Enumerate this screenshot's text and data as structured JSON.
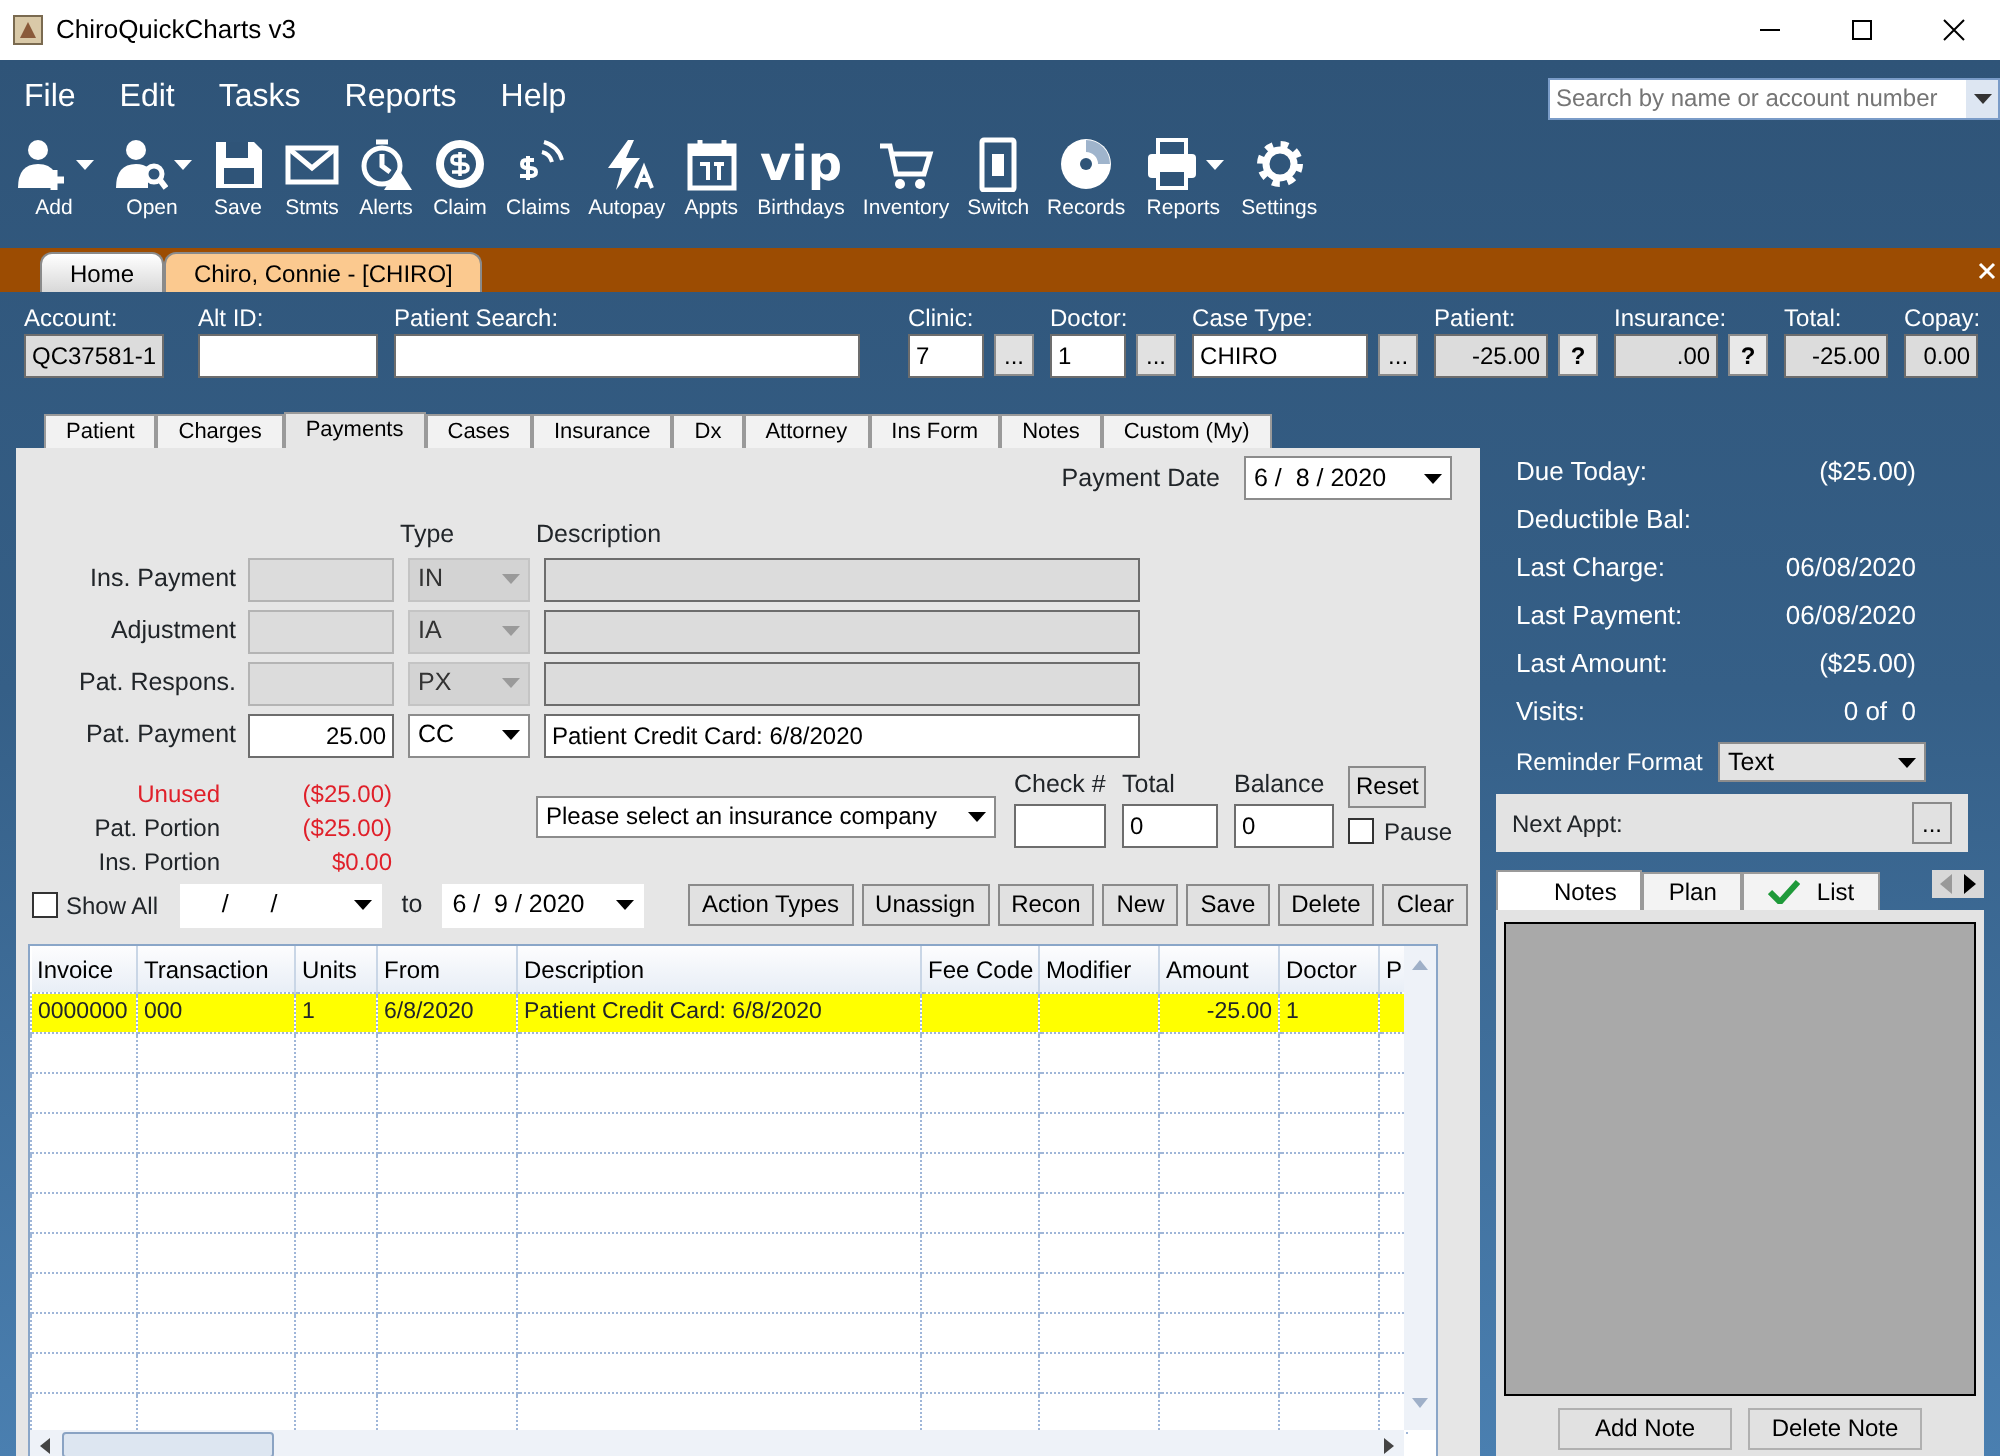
{
  "window": {
    "title": "ChiroQuickCharts v3"
  },
  "menu": [
    "File",
    "Edit",
    "Tasks",
    "Reports",
    "Help"
  ],
  "search": {
    "placeholder": "Search by name or account number"
  },
  "toolbar": [
    {
      "label": "Add",
      "kind": "add",
      "dropdown": true
    },
    {
      "label": "Open",
      "kind": "open",
      "dropdown": true
    },
    {
      "label": "Save",
      "kind": "save",
      "dropdown": false
    },
    {
      "label": "Stmts",
      "kind": "stmts",
      "dropdown": false
    },
    {
      "label": "Alerts",
      "kind": "alerts",
      "dropdown": false
    },
    {
      "label": "Claim",
      "kind": "claim",
      "dropdown": false
    },
    {
      "label": "Claims",
      "kind": "claims",
      "dropdown": false
    },
    {
      "label": "Autopay",
      "kind": "autopay",
      "dropdown": false
    },
    {
      "label": "Appts",
      "kind": "appts",
      "dropdown": false
    },
    {
      "label": "Birthdays",
      "kind": "vip",
      "glyph": "vip",
      "dropdown": false
    },
    {
      "label": "Inventory",
      "kind": "inventory",
      "dropdown": false
    },
    {
      "label": "Switch",
      "kind": "switch",
      "dropdown": false
    },
    {
      "label": "Records",
      "kind": "records",
      "dropdown": false
    },
    {
      "label": "Reports",
      "kind": "reports",
      "dropdown": true
    },
    {
      "label": "Settings",
      "kind": "settings",
      "dropdown": false
    }
  ],
  "doc_tabs": [
    {
      "label": "Home",
      "selected": false
    },
    {
      "label": "Chiro, Connie - [CHIRO]",
      "selected": true
    }
  ],
  "header_fields": [
    {
      "label": "Account:",
      "value": "QC37581-1",
      "kind": "readonly"
    },
    {
      "label": "Alt ID:",
      "kind": "input"
    },
    {
      "label": "Patient Search:",
      "kind": "input"
    },
    {
      "label": "Clinic:",
      "value": "7",
      "kind": "lookup",
      "button": "..."
    },
    {
      "label": "Doctor:",
      "value": "1",
      "kind": "lookup",
      "button": "..."
    },
    {
      "label": "Case Type:",
      "value": "CHIRO",
      "kind": "lookup",
      "button": "..."
    },
    {
      "label": "Patient:",
      "value": "-25.00",
      "kind": "readonly",
      "button": "?"
    },
    {
      "label": "Insurance:",
      "value": ".00",
      "kind": "readonly",
      "button": "?"
    },
    {
      "label": "Total:",
      "value": "-25.00",
      "kind": "readonly"
    },
    {
      "label": "Copay:",
      "value": "0.00",
      "kind": "readonly"
    }
  ],
  "form_tabs": [
    {
      "label": "Patient",
      "selected": false
    },
    {
      "label": "Charges",
      "selected": false
    },
    {
      "label": "Payments",
      "selected": true
    },
    {
      "label": "Cases",
      "selected": false
    },
    {
      "label": "Insurance",
      "selected": false
    },
    {
      "label": "Dx",
      "selected": false
    },
    {
      "label": "Attorney",
      "selected": false
    },
    {
      "label": "Ins Form",
      "selected": false
    },
    {
      "label": "Notes",
      "selected": false
    },
    {
      "label": "Custom (My)",
      "selected": false
    }
  ],
  "payment_date": {
    "label": "Payment Date",
    "value": "6 /  8 / 2020"
  },
  "payment_headers": [
    "Type",
    "Description"
  ],
  "payment_rows": [
    {
      "label": "Ins. Payment",
      "type": "IN",
      "disabled": true
    },
    {
      "label": "Adjustment",
      "type": "IA",
      "disabled": true
    },
    {
      "label": "Pat. Respons.",
      "type": "PX",
      "disabled": true
    },
    {
      "label": "Pat. Payment",
      "amount": "25.00",
      "type": "CC",
      "description": "Patient Credit Card: 6/8/2020",
      "disabled": false
    }
  ],
  "summary": [
    {
      "label": "Unused",
      "value": "($25.00)",
      "alert": true
    },
    {
      "label": "Pat. Portion",
      "value": "($25.00)",
      "alert": false
    },
    {
      "label": "Ins. Portion",
      "value": "$0.00",
      "alert": false
    }
  ],
  "insurance_select": {
    "value": "Please select an insurance company"
  },
  "check_fields": [
    {
      "label": "Check #"
    },
    {
      "label": "Total",
      "value": "0"
    },
    {
      "label": "Balance",
      "value": "0"
    }
  ],
  "reset_button": "Reset",
  "pause": {
    "label": "Pause",
    "checked": false
  },
  "show_all": {
    "label": "Show All",
    "checked": false
  },
  "date_from": {
    "value": "/      /"
  },
  "to_label": "to",
  "date_to": {
    "value": "6 /  9 / 2020"
  },
  "action_buttons": [
    "Action Types",
    "Unassign",
    "Recon",
    "New",
    "Save",
    "Delete",
    "Clear"
  ],
  "table": {
    "columns": [
      "Invoice",
      "Transaction",
      "Units",
      "From",
      "Description",
      "Fee Code",
      "Modifier",
      "Amount",
      "Doctor",
      "P"
    ],
    "rows": [
      {
        "cells": [
          "0000000",
          "000",
          "1",
          "6/8/2020",
          "Patient Credit Card: 6/8/2020",
          null,
          null,
          "-25.00",
          "1",
          null
        ],
        "selected": true
      }
    ]
  },
  "account_summary": [
    {
      "label": "Due Today:",
      "value": "($25.00)"
    },
    {
      "label": "Deductible Bal:"
    },
    {
      "label": "Last Charge:",
      "value": "06/08/2020"
    },
    {
      "label": "Last Payment:",
      "value": "06/08/2020"
    },
    {
      "label": "Last Amount:",
      "value": "($25.00)"
    },
    {
      "label": "Visits:",
      "value": "0 of  0"
    }
  ],
  "reminder_format": {
    "label": "Reminder Format",
    "value": "Text"
  },
  "next_appt": {
    "label": "Next Appt:",
    "button": "..."
  },
  "note_tabs": [
    {
      "label": "Notes",
      "selected": true,
      "kind": "plain"
    },
    {
      "label": "Plan",
      "selected": false,
      "kind": "plain"
    },
    {
      "label": "List",
      "selected": false,
      "kind": "checkmark"
    }
  ],
  "note_buttons": [
    "Add Note",
    "Delete Note"
  ]
}
